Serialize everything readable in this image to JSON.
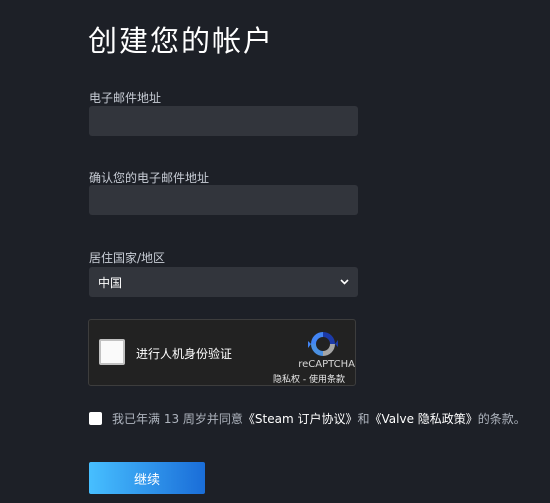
{
  "page": {
    "title": "创建您的帐户"
  },
  "form": {
    "email_label": "电子邮件地址",
    "email_value": "",
    "confirm_email_label": "确认您的电子邮件地址",
    "confirm_email_value": "",
    "country_label": "居住国家/地区",
    "country_value": "中国"
  },
  "recaptcha": {
    "checkbox_text": "进行人机身份验证",
    "brand": "reCAPTCHA",
    "privacy_link": "隐私权",
    "separator": " - ",
    "terms_link": "使用条款"
  },
  "agreement": {
    "prefix": "我已年满 13 周岁并同意",
    "subscriber_agreement": "《Steam 订户协议》",
    "and": "和",
    "privacy_policy": "《Valve 隐私政策》",
    "suffix": "的条款。"
  },
  "actions": {
    "continue_label": "继续"
  },
  "colors": {
    "background": "#1d2027",
    "input_bg": "#32353c",
    "button_gradient_start": "#47bfff",
    "button_gradient_end": "#1a6dd8"
  }
}
